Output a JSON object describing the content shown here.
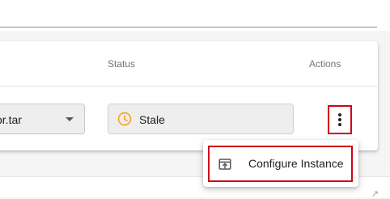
{
  "table": {
    "columns": {
      "status": "Status",
      "actions": "Actions"
    },
    "row": {
      "file_select_value": "or.tar",
      "status": {
        "label": "Stale",
        "icon": "clock-icon",
        "icon_color": "#f5a623"
      }
    }
  },
  "actions_menu": {
    "items": [
      {
        "label": "Configure Instance",
        "icon": "open-in-browser-icon"
      }
    ]
  },
  "colors": {
    "highlight": "#d0021b",
    "stale_accent": "#f5a623"
  }
}
